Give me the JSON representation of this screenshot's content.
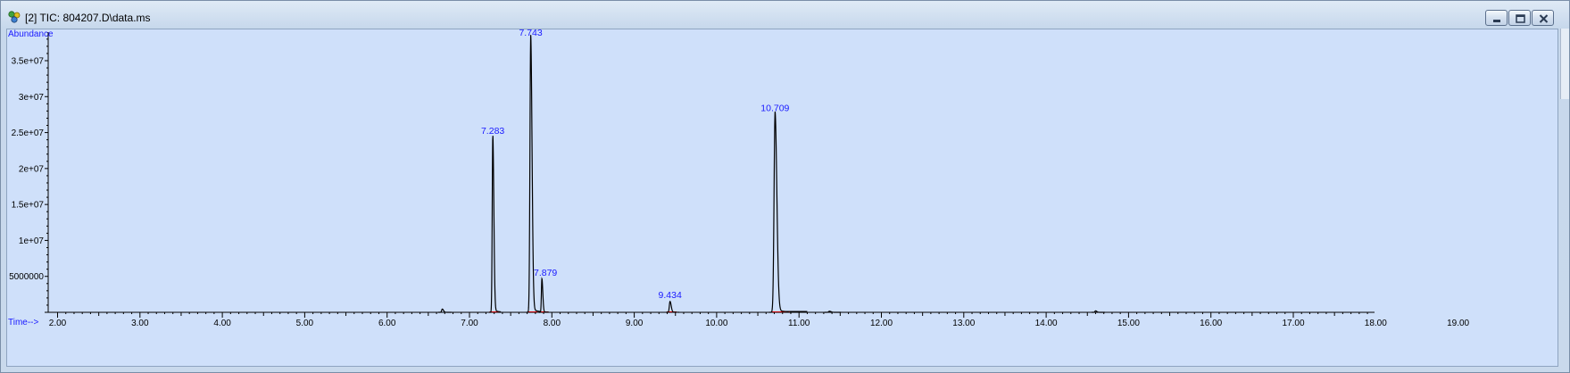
{
  "window": {
    "title": "[2] TIC: 804207.D\\data.ms",
    "icon": "chromatogram-app-icon",
    "controls": [
      "minimize",
      "restore",
      "close"
    ]
  },
  "chart_data": {
    "type": "line",
    "title": "",
    "ylabel": "Abundance",
    "xlabel": "Time-->",
    "xlim": [
      1.9,
      19.9
    ],
    "ylim": [
      0,
      38500000
    ],
    "x_ticks": [
      2,
      3,
      4,
      5,
      6,
      7,
      8,
      9,
      10,
      11,
      12,
      13,
      14,
      15,
      16,
      17,
      18,
      19
    ],
    "x_tick_labels": [
      "2.00",
      "3.00",
      "4.00",
      "5.00",
      "6.00",
      "7.00",
      "8.00",
      "9.00",
      "10.00",
      "11.00",
      "12.00",
      "13.00",
      "14.00",
      "15.00",
      "16.00",
      "17.00",
      "18.00",
      "19.00"
    ],
    "y_ticks": [
      5000000,
      10000000,
      15000000,
      20000000,
      25000000,
      30000000,
      35000000
    ],
    "y_tick_labels": [
      "5000000",
      "1e+07",
      "1.5e+07",
      "2e+07",
      "2.5e+07",
      "3e+07",
      "3.5e+07"
    ],
    "grid": false,
    "colors": {
      "trace": "#000000",
      "baseline": "#cc0000",
      "label": "#1a1aff",
      "background": "#cfe0fa"
    },
    "peaks": [
      {
        "rt": 6.67,
        "height": 450000,
        "width": 0.008,
        "label": ""
      },
      {
        "rt": 7.283,
        "height": 24300000,
        "width": 0.007,
        "label": "7.283"
      },
      {
        "rt": 7.743,
        "height": 38000000,
        "width": 0.009,
        "label": "7.743"
      },
      {
        "rt": 7.879,
        "height": 4600000,
        "width": 0.006,
        "label": "7.879"
      },
      {
        "rt": 9.434,
        "height": 1500000,
        "width": 0.008,
        "label": "9.434"
      },
      {
        "rt": 10.709,
        "height": 27500000,
        "width": 0.012,
        "label": "10.709"
      },
      {
        "rt": 11.37,
        "height": 150000,
        "width": 0.01,
        "label": ""
      },
      {
        "rt": 14.6,
        "height": 200000,
        "width": 0.008,
        "label": ""
      }
    ]
  }
}
